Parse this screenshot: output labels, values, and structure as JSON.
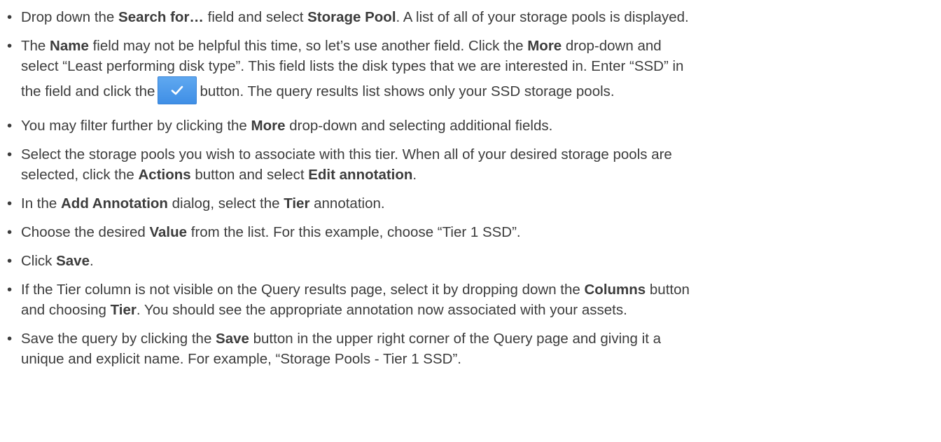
{
  "bullet": "•",
  "steps": [
    {
      "t1": "Drop down the ",
      "b1": "Search for…",
      "t2": " field and select ",
      "b2": "Storage Pool",
      "t3": ". A list of all of your storage pools is displayed."
    },
    {
      "t1": "The ",
      "b1": "Name",
      "t2": " field may not be helpful this time, so let’s use another field. Click the ",
      "b2": "More",
      "t3": " drop-down and",
      "l2": "select “Least performing disk type”. This field lists the disk types that we are interested in. Enter “SSD” in",
      "l3a": "the field and click the",
      "l3b": "button. The query results list shows only your SSD storage pools.",
      "button_icon": "check-icon"
    },
    {
      "t1": "You may filter further by clicking the ",
      "b1": "More",
      "t2": " drop-down and selecting additional fields."
    },
    {
      "t1": "Select the storage pools you wish to associate with this tier. When all of your desired storage pools are",
      "l2a": "selected, click the ",
      "b1": "Actions",
      "l2b": " button and select ",
      "b2": "Edit annotation",
      "l2c": "."
    },
    {
      "t1": "In the ",
      "b1": "Add Annotation",
      "t2": " dialog, select the ",
      "b2": "Tier",
      "t3": " annotation."
    },
    {
      "t1": "Choose the desired ",
      "b1": "Value",
      "t2": " from the list. For this example, choose “Tier 1 SSD”."
    },
    {
      "t1": "Click ",
      "b1": "Save",
      "t2": "."
    },
    {
      "t1": "If the Tier column is not visible on the Query results page, select it by dropping down the ",
      "b1": "Columns",
      "t2": " button",
      "l2a": "and choosing ",
      "b2": "Tier",
      "l2b": ". You should see the appropriate annotation now associated with your assets."
    },
    {
      "t1": "Save the query by clicking the ",
      "b1": "Save",
      "t2": " button in the upper right corner of the Query page and giving it a",
      "l2": "unique and explicit name. For example, “Storage Pools - Tier 1 SSD”."
    }
  ],
  "colors": {
    "text": "#3c3c3c",
    "button_top": "#5fa8f0",
    "button_bottom": "#3f8fe6"
  }
}
